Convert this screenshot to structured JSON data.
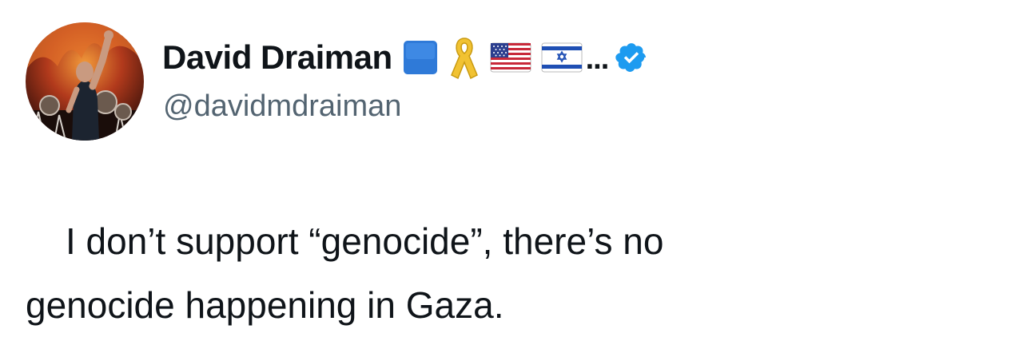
{
  "author": {
    "display_name": "David Draiman",
    "handle": "@davidmdraiman",
    "name_badges": [
      "blue-square-icon",
      "yellow-ribbon-icon",
      "us-flag-icon",
      "israel-flag-icon"
    ],
    "truncation": "...",
    "verified": true,
    "verified_color": "#1d9bf0"
  },
  "tweet": {
    "text_line_1": "I don’t support “genocide”, there’s no",
    "text_line_2": "genocide happening in Gaza."
  },
  "colors": {
    "text": "#0f1419",
    "secondary_text": "#536471",
    "background": "#ffffff"
  }
}
